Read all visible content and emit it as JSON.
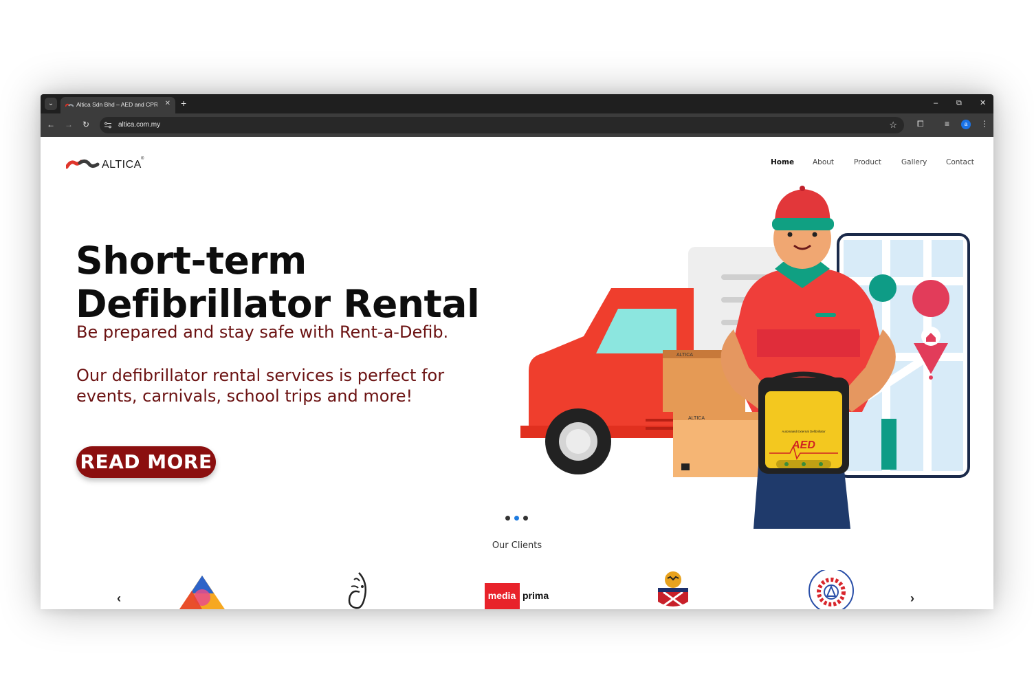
{
  "browser": {
    "tab_title": "Altica Sdn Bhd – AED and CPR",
    "tab_close": "✕",
    "new_tab": "+",
    "tab_search": "⌄",
    "url": "altica.com.my",
    "win_min": "–",
    "win_restore": "⧉",
    "win_close": "✕",
    "avatar_letter": "a",
    "back": "←",
    "forward": "→",
    "reload": "↻",
    "star": "☆",
    "extensions": "⧠",
    "media": "≡",
    "menu": "⋮"
  },
  "site": {
    "logo_text": "ALTICA",
    "logo_reg": "®",
    "nav": [
      {
        "label": "Home",
        "active": true
      },
      {
        "label": "About",
        "active": false
      },
      {
        "label": "Product",
        "active": false
      },
      {
        "label": "Gallery",
        "active": false
      },
      {
        "label": "Contact",
        "active": false
      }
    ],
    "hero": {
      "title_line1": "Short-term",
      "title_line2": "Defibrillator Rental",
      "tagline": "Be prepared and stay safe with Rent-a-Defib.",
      "desc_line1": "Our defibrillator rental services is perfect for",
      "desc_line2": "events, carnivals, school trips and more!",
      "cta": "READ MORE",
      "box_brand": "ALTICA",
      "bag_label": "Automated External Defibrillator",
      "bag_aed": "AED"
    },
    "carousel": {
      "slides": 3,
      "active_index": 1
    },
    "clients": {
      "title": "Our Clients",
      "prev": "‹",
      "next": "›",
      "logos": [
        "triangle-logo",
        "calligraphy-logo",
        "media-prima-logo",
        "crest-logo",
        "majlis-amanah-rakyat-logo"
      ],
      "media_word": "media",
      "prima_word": "prima"
    }
  },
  "colors": {
    "brand_red": "#8b0f0f",
    "tagline": "#6b1212",
    "active_dot": "#1e7be0"
  }
}
